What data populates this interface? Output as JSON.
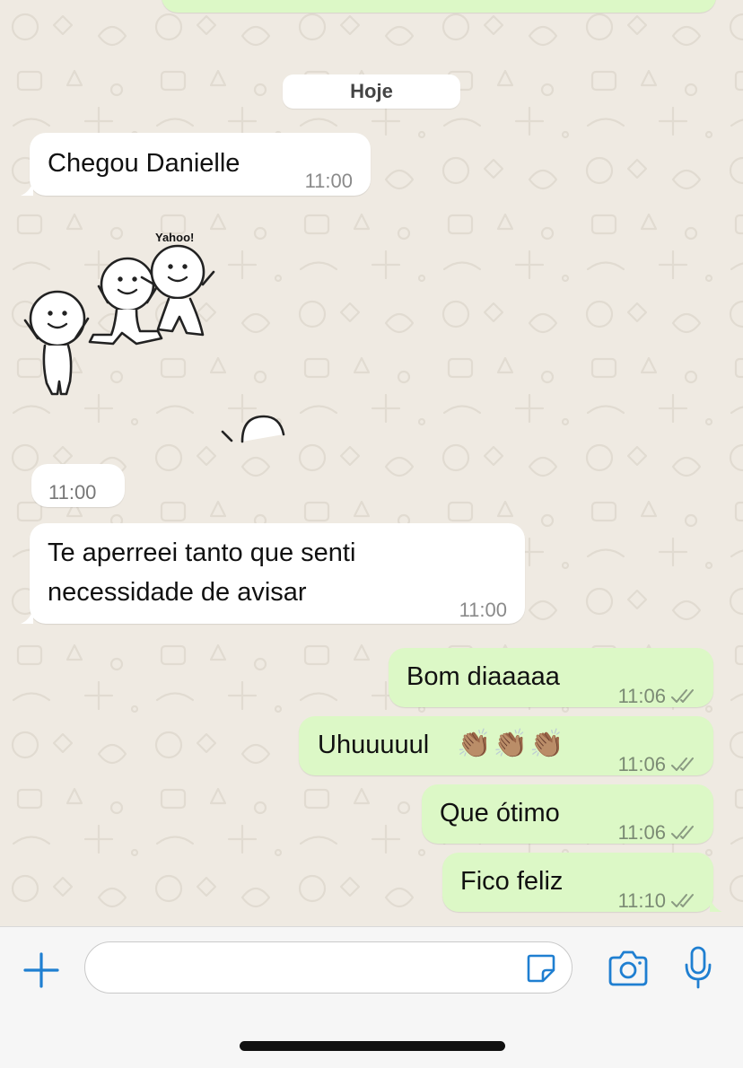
{
  "date_separator": "Hoje",
  "messages": [
    {
      "direction": "in",
      "text": "Chegou Danielle",
      "time": "11:00"
    },
    {
      "direction": "in",
      "type": "sticker",
      "sticker_caption": "Yahoo!",
      "time": "11:00"
    },
    {
      "direction": "in",
      "text_line1": "Te aperreei tanto que senti",
      "text_line2": "necessidade de avisar",
      "time": "11:00"
    },
    {
      "direction": "out",
      "text": "Bom diaaaaa",
      "time": "11:06",
      "status": "read-double-check-icon"
    },
    {
      "direction": "out",
      "text": "Uhuuuuul",
      "emoji": "👏🏽👏🏽👏🏽",
      "time": "11:06",
      "status": "read-double-check-icon"
    },
    {
      "direction": "out",
      "text": "Que ótimo",
      "time": "11:06",
      "status": "read-double-check-icon"
    },
    {
      "direction": "out",
      "text": "Fico feliz",
      "time": "11:10",
      "status": "read-double-check-icon"
    }
  ],
  "composer": {
    "input_value": "",
    "icons": [
      "plus-icon",
      "sticker-icon",
      "camera-icon",
      "microphone-icon"
    ]
  },
  "colors": {
    "background": "#efeae2",
    "incoming_bubble": "#ffffff",
    "outgoing_bubble": "#dcf8c6",
    "accent": "#1f7fd1"
  }
}
